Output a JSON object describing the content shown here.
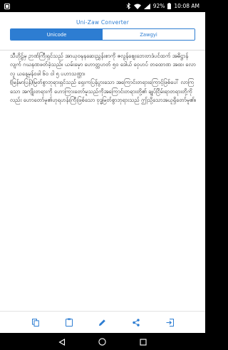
{
  "status_bar": {
    "battery_percent": "92%",
    "time": "10:08 AM"
  },
  "header": {
    "title": "Uni-Zaw Converter"
  },
  "tabs": [
    {
      "label": "Unicode",
      "active": true
    },
    {
      "label": "Zawgyi",
      "active": false
    }
  ],
  "editor": {
    "paragraphs": [
      "သီဟိုဠ်မှ ဉာဏ်ကြီးရှင်သည် အာယုဝဍ္ဎနဆေးညွှန်းစာကို ဇလွန်ဈေးဘေးဗာဒံပင်ထက် အဓိဋ္ဌာန်လျက် ဂဃနဏဖတ်ခဲ့သည်။ ယမ်းမှော ဟောတ္ထဟတ် ၅၀ ဒေါယ် ဝှေဟပ် တထောဏ အထ၊ လောလူ ယနေ့မှန်ဝဖါ ၆ဝ ဝါ ၅ ပဟာသဏ္ဌာ၊",
      "(မြန်မာပြန်)မြတ်စွာဘုရားရှင်သည် ရှေးကပြန်ပွားသော အကြောင်းတရားကြောင့်ဖြစ်ပေါ် လာကြသော အကျိုးတရားကို ဟောကြားတော်မူသည်ကိုအကြောင်းတရားတို့၏ ချုပ်ငြိမ်းရာတရားတို့ကိုလည်း ဟောတော်မူ၏ဟုရဟန်းကြီးဖြစ်သော ဗုဒ္ဓမြတ်စွာဘုရားသည် ဤသို့သောအယူရှိတော်မူ၏။"
    ]
  },
  "toolbar": {
    "buttons": [
      {
        "name": "copy-button",
        "icon": "copy-icon"
      },
      {
        "name": "paste-button",
        "icon": "clipboard-icon"
      },
      {
        "name": "edit-button",
        "icon": "pencil-icon"
      },
      {
        "name": "share-button",
        "icon": "share-icon"
      },
      {
        "name": "export-button",
        "icon": "login-icon"
      }
    ]
  },
  "colors": {
    "accent": "#2d7dd2"
  }
}
